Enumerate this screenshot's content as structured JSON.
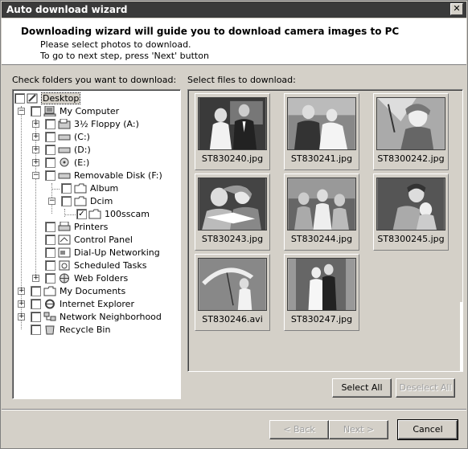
{
  "window": {
    "title": "Auto download wizard",
    "close_glyph": "✕"
  },
  "header": {
    "title": "Downloading wizard will guide you to download camera images to PC",
    "line1": "Please select photos to download.",
    "line2": "To go to next step, press 'Next' button"
  },
  "folders_label": "Check folders you want to download:",
  "files_label": "Select files to download:",
  "tree": [
    {
      "label": "Desktop",
      "icon": "desktop-icon"
    },
    {
      "label": "My Computer",
      "icon": "computer-icon"
    },
    {
      "label": "3½ Floppy (A:)",
      "icon": "floppy-icon"
    },
    {
      "label": "(C:)",
      "icon": "drive-icon"
    },
    {
      "label": "(D:)",
      "icon": "drive-icon"
    },
    {
      "label": "(E:)",
      "icon": "cd-icon"
    },
    {
      "label": "Removable Disk (F:)",
      "icon": "drive-icon"
    },
    {
      "label": "Album",
      "icon": "folder-icon"
    },
    {
      "label": "Dcim",
      "icon": "folder-icon"
    },
    {
      "label": "100sscam",
      "icon": "folder-icon"
    },
    {
      "label": "Printers",
      "icon": "printer-icon"
    },
    {
      "label": "Control Panel",
      "icon": "control-panel-icon"
    },
    {
      "label": "Dial-Up Networking",
      "icon": "network-icon"
    },
    {
      "label": "Scheduled Tasks",
      "icon": "tasks-icon"
    },
    {
      "label": "Web Folders",
      "icon": "globe-icon"
    },
    {
      "label": "My Documents",
      "icon": "folder-icon"
    },
    {
      "label": "Internet Explorer",
      "icon": "ie-icon"
    },
    {
      "label": "Network Neighborhood",
      "icon": "network-icon"
    },
    {
      "label": "Recycle Bin",
      "icon": "recycle-icon"
    }
  ],
  "checked_mark": "✓",
  "files": [
    {
      "name": "ST830240.jpg"
    },
    {
      "name": "ST830241.jpg"
    },
    {
      "name": "ST8300242.jpg"
    },
    {
      "name": "ST830243.jpg"
    },
    {
      "name": "ST830244.jpg"
    },
    {
      "name": "ST8300245.jpg"
    },
    {
      "name": "ST830246.avi"
    },
    {
      "name": "ST830247.jpg"
    }
  ],
  "buttons": {
    "select_all": "Select All",
    "deselect_all": "Deselect All",
    "back": "< Back",
    "next": "Next >",
    "cancel": "Cancel"
  }
}
